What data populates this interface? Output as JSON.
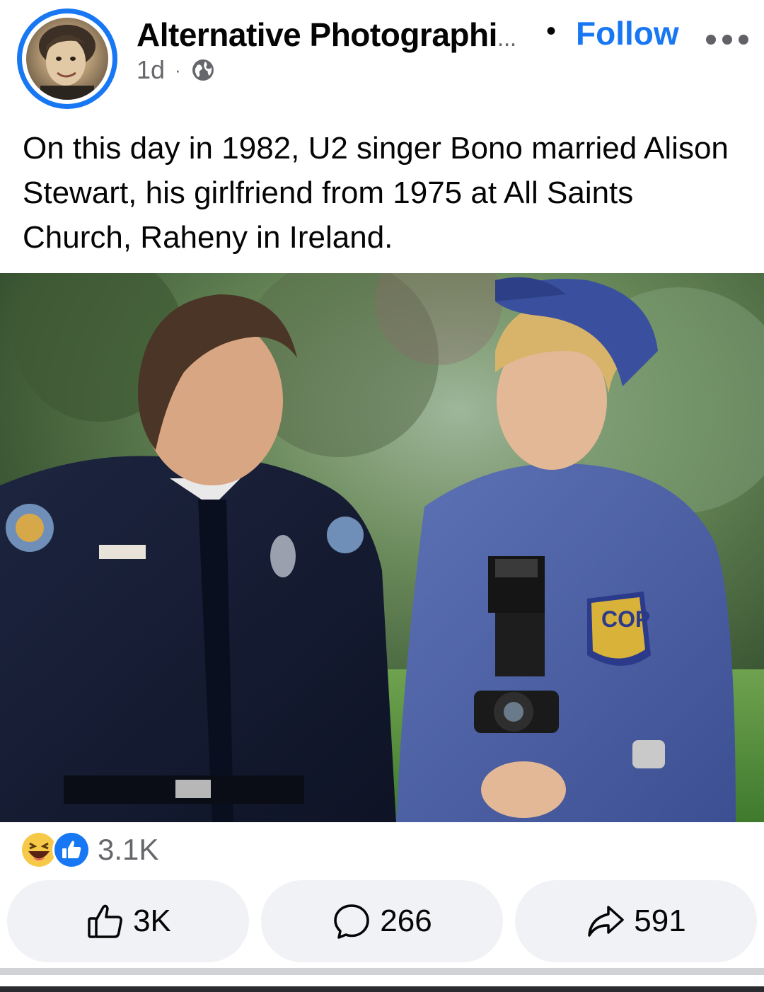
{
  "post": {
    "page_name": "Alternative Photographi",
    "page_name_ellipsis": "...",
    "separator": "•",
    "follow_label": "Follow",
    "time": "1d",
    "meta_separator": "·",
    "privacy_icon": "globe-icon",
    "more_icon": "more-dots-icon",
    "text": "On this day in 1982, U2 singer Bono married Alison Stewart, his girlfriend from 1975 at All Saints Church, Raheny in Ireland."
  },
  "photo": {
    "patch_text": "COP",
    "description_hidden": true
  },
  "reactions": {
    "icons": [
      "haha-icon",
      "like-icon"
    ],
    "count": "3.1K"
  },
  "actions": {
    "like_count": "3K",
    "comment_count": "266",
    "share_count": "591",
    "like_icon": "thumbs-up-icon",
    "comment_icon": "comment-bubble-icon",
    "share_icon": "share-arrow-icon"
  },
  "colors": {
    "accent": "#1877f2",
    "secondary_text": "#65676b",
    "button_bg": "#f0f2f5"
  }
}
